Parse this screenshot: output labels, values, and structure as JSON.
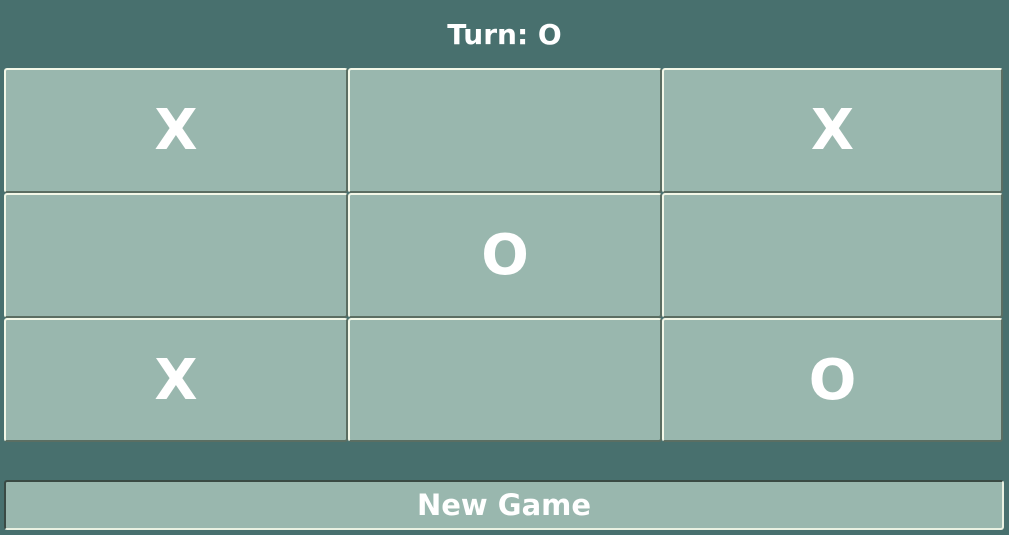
{
  "status": {
    "turn_text": "Turn: O"
  },
  "board": {
    "cells": [
      [
        "X",
        "",
        "X"
      ],
      [
        "",
        "O",
        ""
      ],
      [
        "X",
        "",
        "O"
      ]
    ]
  },
  "controls": {
    "new_game_label": "New Game"
  },
  "colors": {
    "background": "#48706e",
    "cell": "#99b7ae",
    "mark": "#ffffff"
  }
}
